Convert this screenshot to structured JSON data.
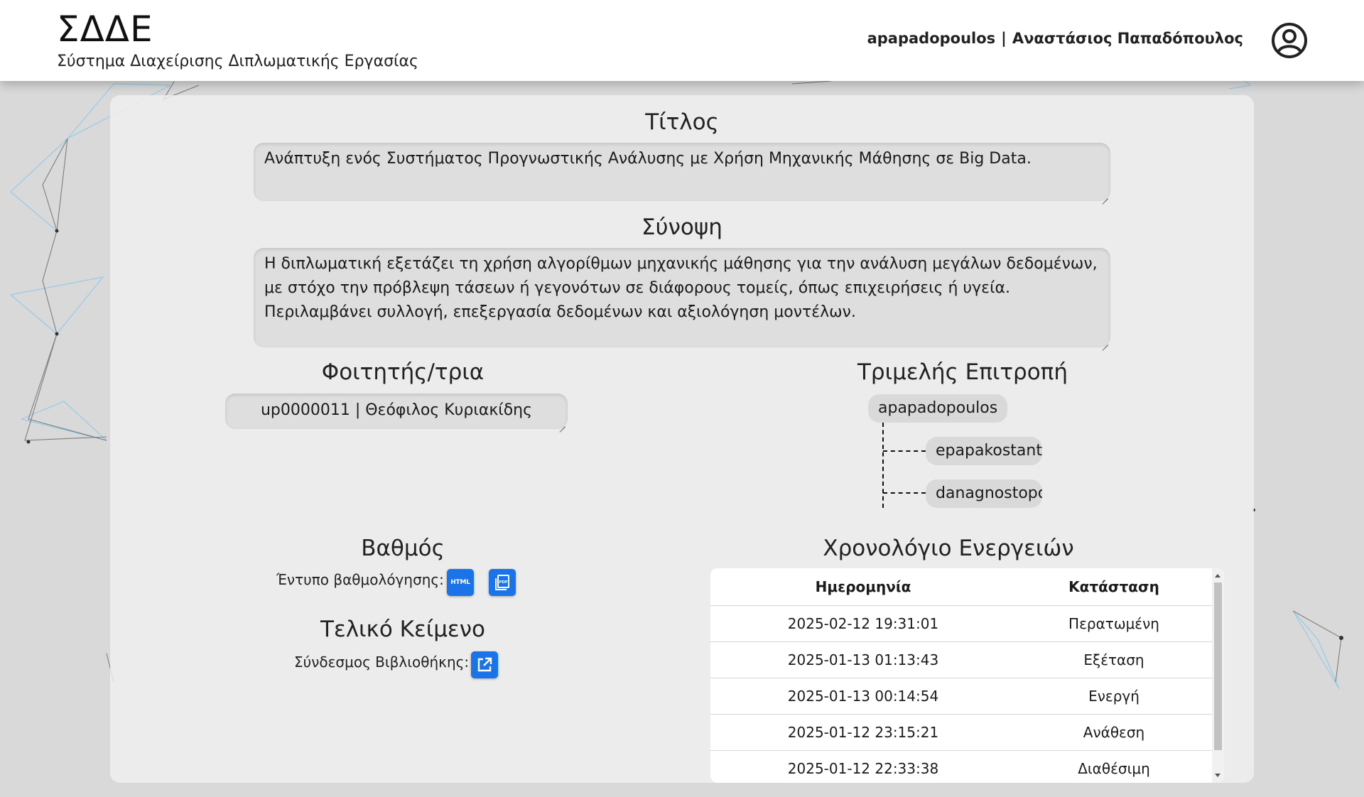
{
  "header": {
    "logo": "ΣΔΔΕ",
    "subtitle": "Σύστημα Διαχείρισης Διπλωματικής Εργασίας",
    "username": "apapadopoulos",
    "separator": "|",
    "full_name": "Αναστάσιος Παπαδόπουλος",
    "avatar_icon": "user-circle-icon"
  },
  "thesis": {
    "title_heading": "Τίτλος",
    "title_value": "Ανάπτυξη ενός Συστήματος Προγνωστικής Ανάλυσης με Χρήση Μηχανικής Μάθησης σε Big Data.",
    "summary_heading": "Σύνοψη",
    "summary_value": "Η διπλωματική εξετάζει τη χρήση αλγορίθμων μηχανικής μάθησης για την ανάλυση μεγάλων δεδομένων, με στόχο την πρόβλεψη τάσεων ή γεγονότων σε διάφορους τομείς, όπως επιχειρήσεις ή υγεία. Περιλαμβάνει συλλογή, επεξεργασία δεδομένων και αξιολόγηση μοντέλων."
  },
  "student": {
    "heading": "Φοιτητής/τρια",
    "value": "up0000011 | Θεόφιλος Κυριακίδης"
  },
  "committee": {
    "heading": "Τριμελής Επιτροπή",
    "supervisor": "apapadopoulos",
    "members": [
      "epapakostantino",
      "danagnostopou"
    ]
  },
  "grade": {
    "heading": "Βαθμός",
    "form_label": "Έντυπο βαθμολόγησης:",
    "html_icon": "html-file-icon",
    "html_icon_text": "HTML",
    "pdf_icon": "pdf-file-icon"
  },
  "final_text": {
    "heading": "Τελικό Κείμενο",
    "library_label": "Σύνδεσμος Βιβλιοθήκης:",
    "link_icon": "external-link-icon"
  },
  "history": {
    "heading": "Χρονολόγιο Ενεργειών",
    "columns": [
      "Ημερομηνία",
      "Κατάσταση"
    ],
    "rows": [
      {
        "date": "2025-02-12 19:31:01",
        "status": "Περατωμένη"
      },
      {
        "date": "2025-01-13 01:13:43",
        "status": "Εξέταση"
      },
      {
        "date": "2025-01-13 00:14:54",
        "status": "Ενεργή"
      },
      {
        "date": "2025-01-12 23:15:21",
        "status": "Ανάθεση"
      },
      {
        "date": "2025-01-12 22:33:38",
        "status": "Διαθέσιμη"
      }
    ]
  },
  "colors": {
    "accent": "#1a73e8",
    "header_bg": "#ffffff",
    "page_bg": "#d9d9d9"
  }
}
